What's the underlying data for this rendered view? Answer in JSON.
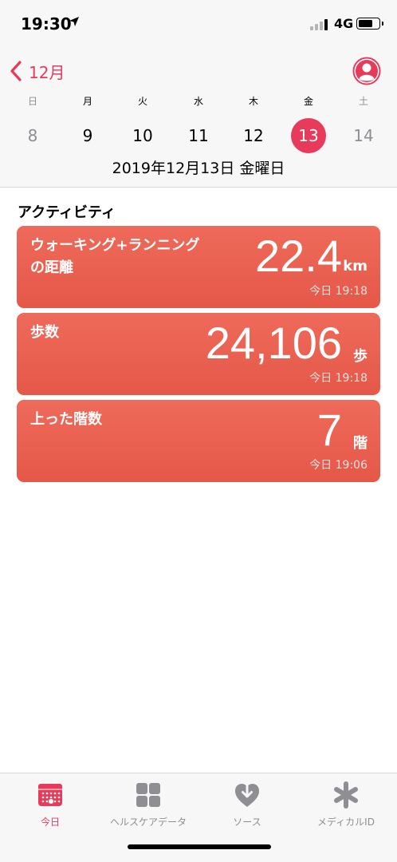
{
  "status": {
    "time": "19:30",
    "network": "4G"
  },
  "header": {
    "back_label": "12月",
    "week": [
      {
        "dow": "日",
        "num": "8",
        "weekend": true,
        "selected": false
      },
      {
        "dow": "月",
        "num": "9",
        "weekend": false,
        "selected": false
      },
      {
        "dow": "火",
        "num": "10",
        "weekend": false,
        "selected": false
      },
      {
        "dow": "水",
        "num": "11",
        "weekend": false,
        "selected": false
      },
      {
        "dow": "木",
        "num": "12",
        "weekend": false,
        "selected": false
      },
      {
        "dow": "金",
        "num": "13",
        "weekend": false,
        "selected": true
      },
      {
        "dow": "土",
        "num": "14",
        "weekend": true,
        "selected": false
      }
    ],
    "date_title": "2019年12月13日 金曜日"
  },
  "section": {
    "title": "アクティビティ"
  },
  "cards": [
    {
      "title_line1": "ウォーキング+ランニング",
      "title_line2": "の距離",
      "value": "22.4",
      "unit": "km",
      "time": "今日 19:18"
    },
    {
      "title_line1": "歩数",
      "title_line2": "",
      "value": "24,106",
      "unit": "歩",
      "time": "今日 19:18"
    },
    {
      "title_line1": "上った階数",
      "title_line2": "",
      "value": "7",
      "unit": "階",
      "time": "今日 19:06"
    }
  ],
  "tabs": [
    {
      "label": "今日",
      "icon": "calendar-icon",
      "active": true
    },
    {
      "label": "ヘルスケアデータ",
      "icon": "grid-icon",
      "active": false
    },
    {
      "label": "ソース",
      "icon": "heart-download-icon",
      "active": false
    },
    {
      "label": "メディカルID",
      "icon": "asterisk-icon",
      "active": false
    }
  ],
  "colors": {
    "accent": "#e83a5a",
    "card": "#ea5f4f",
    "inactive": "#8e8e93"
  }
}
